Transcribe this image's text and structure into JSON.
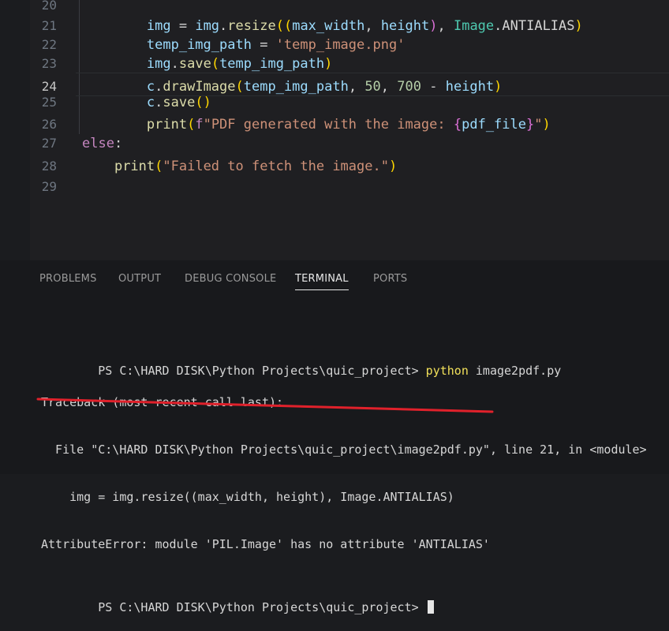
{
  "editor": {
    "lines": [
      {
        "number": "20",
        "indent": "    ",
        "tokens": []
      },
      {
        "number": "21",
        "indent": "        ",
        "tokens": [
          {
            "text": "img",
            "kind": "var"
          },
          {
            "text": " = ",
            "kind": "op"
          },
          {
            "text": "img",
            "kind": "var"
          },
          {
            "text": ".",
            "kind": "op"
          },
          {
            "text": "resize",
            "kind": "func"
          },
          {
            "text": "((",
            "kind": "paren1"
          },
          {
            "text": "max_width",
            "kind": "var"
          },
          {
            "text": ", ",
            "kind": "op"
          },
          {
            "text": "height",
            "kind": "var"
          },
          {
            "text": ")",
            "kind": "paren2"
          },
          {
            "text": ", ",
            "kind": "op"
          },
          {
            "text": "Image",
            "kind": "cls"
          },
          {
            "text": ".ANTIALIAS",
            "kind": "op"
          },
          {
            "text": ")",
            "kind": "paren1"
          }
        ]
      },
      {
        "number": "22",
        "indent": "        ",
        "tokens": [
          {
            "text": "temp_img_path",
            "kind": "var"
          },
          {
            "text": " = ",
            "kind": "op"
          },
          {
            "text": "'temp_image.png'",
            "kind": "str"
          }
        ]
      },
      {
        "number": "23",
        "indent": "        ",
        "tokens": [
          {
            "text": "img",
            "kind": "var"
          },
          {
            "text": ".",
            "kind": "op"
          },
          {
            "text": "save",
            "kind": "func"
          },
          {
            "text": "(",
            "kind": "paren1"
          },
          {
            "text": "temp_img_path",
            "kind": "var"
          },
          {
            "text": ")",
            "kind": "paren1"
          }
        ]
      },
      {
        "number": "24",
        "indent": "        ",
        "tokens": [
          {
            "text": "c",
            "kind": "var"
          },
          {
            "text": ".",
            "kind": "op"
          },
          {
            "text": "drawImage",
            "kind": "func"
          },
          {
            "text": "(",
            "kind": "paren1"
          },
          {
            "text": "temp_img_path",
            "kind": "var"
          },
          {
            "text": ", ",
            "kind": "op"
          },
          {
            "text": "50",
            "kind": "num"
          },
          {
            "text": ", ",
            "kind": "op"
          },
          {
            "text": "700",
            "kind": "num"
          },
          {
            "text": " - ",
            "kind": "op"
          },
          {
            "text": "height",
            "kind": "var"
          },
          {
            "text": ")",
            "kind": "paren1"
          }
        ]
      },
      {
        "number": "25",
        "indent": "        ",
        "tokens": [
          {
            "text": "c",
            "kind": "var"
          },
          {
            "text": ".",
            "kind": "op"
          },
          {
            "text": "save",
            "kind": "func"
          },
          {
            "text": "()",
            "kind": "paren1"
          }
        ]
      },
      {
        "number": "26",
        "indent": "        ",
        "tokens": [
          {
            "text": "print",
            "kind": "func"
          },
          {
            "text": "(",
            "kind": "paren1"
          },
          {
            "text": "f",
            "kind": "kw"
          },
          {
            "text": "\"PDF generated with the image: ",
            "kind": "str"
          },
          {
            "text": "{",
            "kind": "brace"
          },
          {
            "text": "pdf_file",
            "kind": "var"
          },
          {
            "text": "}",
            "kind": "brace"
          },
          {
            "text": "\"",
            "kind": "str"
          },
          {
            "text": ")",
            "kind": "paren1"
          }
        ]
      },
      {
        "number": "27",
        "indent": "",
        "tokens": [
          {
            "text": "else",
            "kind": "kw"
          },
          {
            "text": ":",
            "kind": "op"
          }
        ]
      },
      {
        "number": "28",
        "indent": "    ",
        "tokens": [
          {
            "text": "print",
            "kind": "func"
          },
          {
            "text": "(",
            "kind": "paren1"
          },
          {
            "text": "\"Failed to fetch the image.\"",
            "kind": "str"
          },
          {
            "text": ")",
            "kind": "paren1"
          }
        ]
      },
      {
        "number": "29",
        "indent": "",
        "tokens": []
      }
    ],
    "active_line": "24"
  },
  "panel": {
    "tabs": [
      {
        "label": "PROBLEMS",
        "active": false
      },
      {
        "label": "OUTPUT",
        "active": false
      },
      {
        "label": "DEBUG CONSOLE",
        "active": false
      },
      {
        "label": "TERMINAL",
        "active": true
      },
      {
        "label": "PORTS",
        "active": false
      }
    ]
  },
  "terminal": {
    "prompt_line": {
      "prompt": "PS C:\\HARD DISK\\Python Projects\\quic_project> ",
      "command": "python",
      "args": " image2pdf.py"
    },
    "output_lines": [
      "Traceback (most recent call last):",
      "  File \"C:\\HARD DISK\\Python Projects\\quic_project\\image2pdf.py\", line 21, in <module>",
      "    img = img.resize((max_width, height), Image.ANTIALIAS)",
      "AttributeError: module 'PIL.Image' has no attribute 'ANTIALIAS'"
    ],
    "final_prompt": "PS C:\\HARD DISK\\Python Projects\\quic_project> "
  },
  "colors": {
    "annotation_underline": "#e0212b",
    "command_highlight": "#f1e05a"
  }
}
